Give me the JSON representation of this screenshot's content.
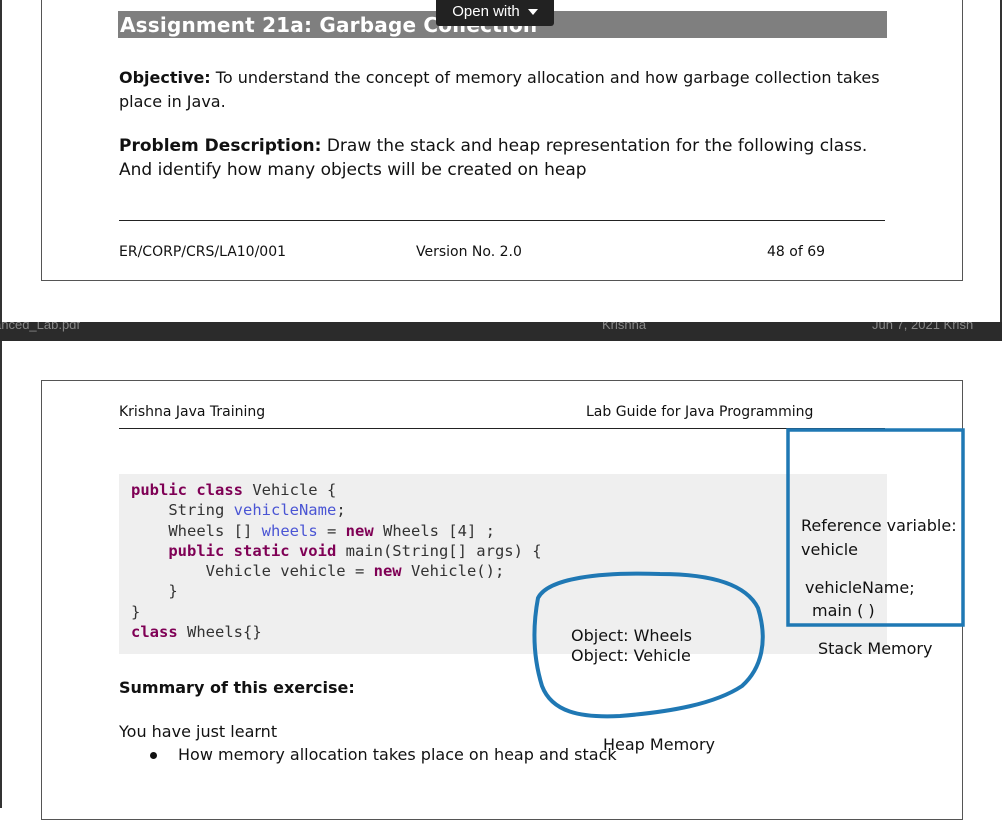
{
  "toolbar": {
    "open_with_label": "Open with"
  },
  "page1": {
    "title": "Assignment 21a: Garbage Collection",
    "objective_label": "Objective:",
    "objective_text": " To understand the concept of memory allocation and how garbage collection takes place in Java.",
    "problem_label": "Problem Description:",
    "problem_text": " Draw the stack and heap representation for the following class. And identify how many objects will be created on heap",
    "footer": {
      "doc_id": "ER/CORP/CRS/LA10/001",
      "version": "Version No. 2.0",
      "page": "48 of 69"
    }
  },
  "separator": {
    "file_name": "anced_Lab.pdf",
    "owner": "Krishna",
    "date": "Jun 7, 2021 Krish"
  },
  "page2": {
    "header_left": "Krishna Java Training",
    "header_right": "Lab Guide for Java Programming",
    "code": {
      "l1_kw": "public class",
      "l1_rest": " Vehicle {",
      "l2_type": "    String ",
      "l2_field": "vehicleName",
      "l2_end": ";",
      "l3_type": "    Wheels [] ",
      "l3_field": "wheels",
      "l3_eq": " = ",
      "l3_kw": "new",
      "l3_end": " Wheels [4] ;",
      "l4_kw": "    public static void",
      "l4_rest": " main(String[] args) {",
      "l5_a": "        Vehicle vehicle = ",
      "l5_kw": "new",
      "l5_end": " Vehicle();",
      "l6": "    }",
      "l7": "}",
      "l8_kw": "class",
      "l8_rest": " Wheels{}"
    },
    "summary_title": "Summary of this exercise:",
    "learnt_text": "You have just learnt",
    "bullets": [
      "How memory allocation takes place on heap and stack"
    ]
  },
  "annotations": {
    "ref_line1": "Reference variable:",
    "ref_line2": "vehicle",
    "vehicle_name": "vehicleName;",
    "main": "main ( )",
    "stack_label": "Stack Memory",
    "obj_wheels": "Object: Wheels",
    "obj_vehicle": "Object: Vehicle",
    "heap_label": "Heap Memory",
    "ink_color": "#1f78b4"
  }
}
